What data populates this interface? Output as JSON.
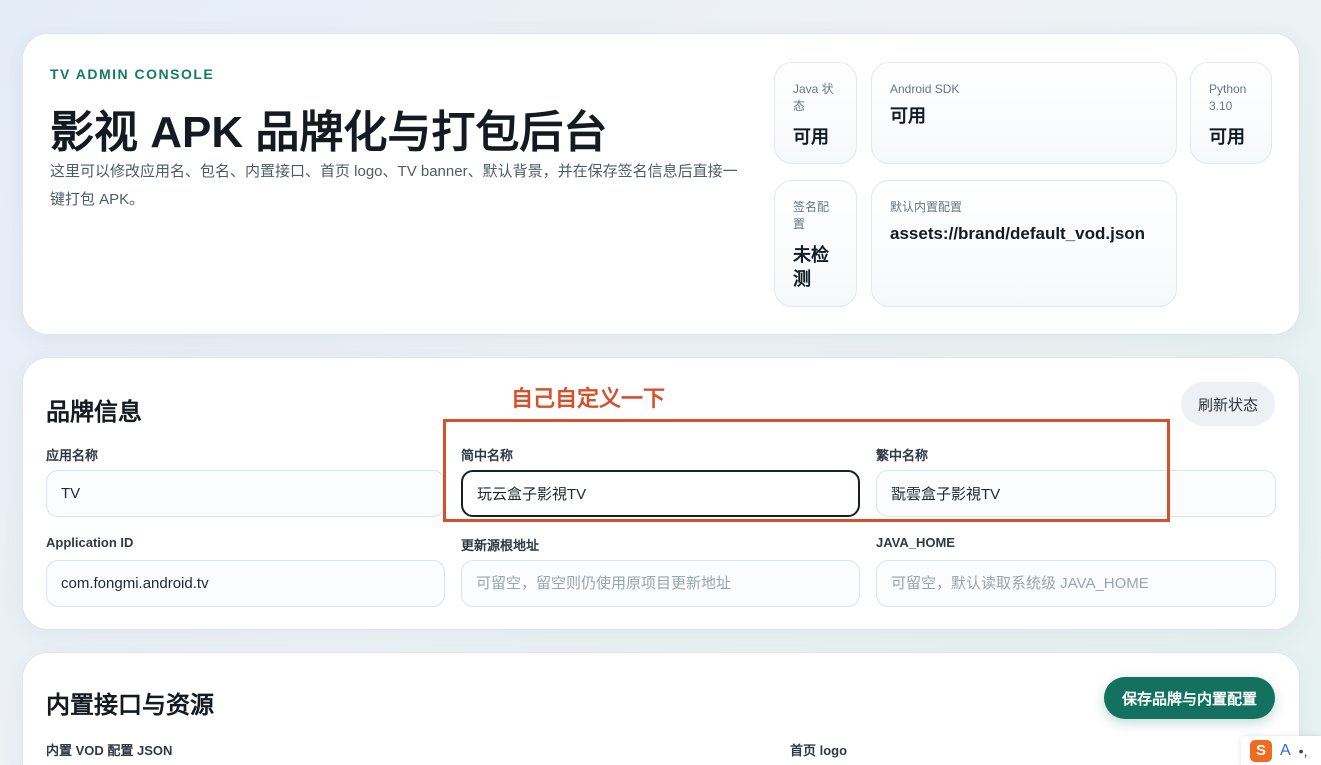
{
  "hero": {
    "eyebrow": "TV ADMIN CONSOLE",
    "title": "影视 APK 品牌化与打包后台",
    "description": "这里可以修改应用名、包名、内置接口、首页 logo、TV banner、默认背景，并在保存签名信息后直接一键打包 APK。"
  },
  "status": {
    "java": {
      "label": "Java 状态",
      "value": "可用"
    },
    "android_sdk": {
      "label": "Android SDK",
      "value": "可用"
    },
    "python": {
      "label": "Python 3.10",
      "value": "可用"
    },
    "signing": {
      "label": "签名配置",
      "value": "未检测"
    },
    "default_config": {
      "label": "默认内置配置",
      "value": "assets://brand/default_vod.json"
    }
  },
  "brand": {
    "title": "品牌信息",
    "refresh_label": "刷新状态",
    "annotation": "自己自定义一下",
    "fields": {
      "app_name": {
        "label": "应用名称",
        "value": "TV",
        "placeholder": ""
      },
      "simplified_name": {
        "label": "简中名称",
        "value": "玩云盒子影視TV",
        "placeholder": ""
      },
      "traditional_name": {
        "label": "繁中名称",
        "value": "翫雲盒子影視TV",
        "placeholder": ""
      },
      "application_id": {
        "label": "Application ID",
        "value": "com.fongmi.android.tv",
        "placeholder": ""
      },
      "update_url": {
        "label": "更新源根地址",
        "value": "",
        "placeholder": "可留空，留空则仍使用原项目更新地址"
      },
      "java_home": {
        "label": "JAVA_HOME",
        "value": "",
        "placeholder": "可留空，默认读取系统级 JAVA_HOME"
      }
    }
  },
  "resources": {
    "title": "内置接口与资源",
    "save_label": "保存品牌与内置配置",
    "vod_json_label": "内置 VOD 配置 JSON",
    "logo_label": "首页 logo"
  },
  "ime": {
    "logo": "S",
    "mode": "A",
    "punct": "•,"
  }
}
